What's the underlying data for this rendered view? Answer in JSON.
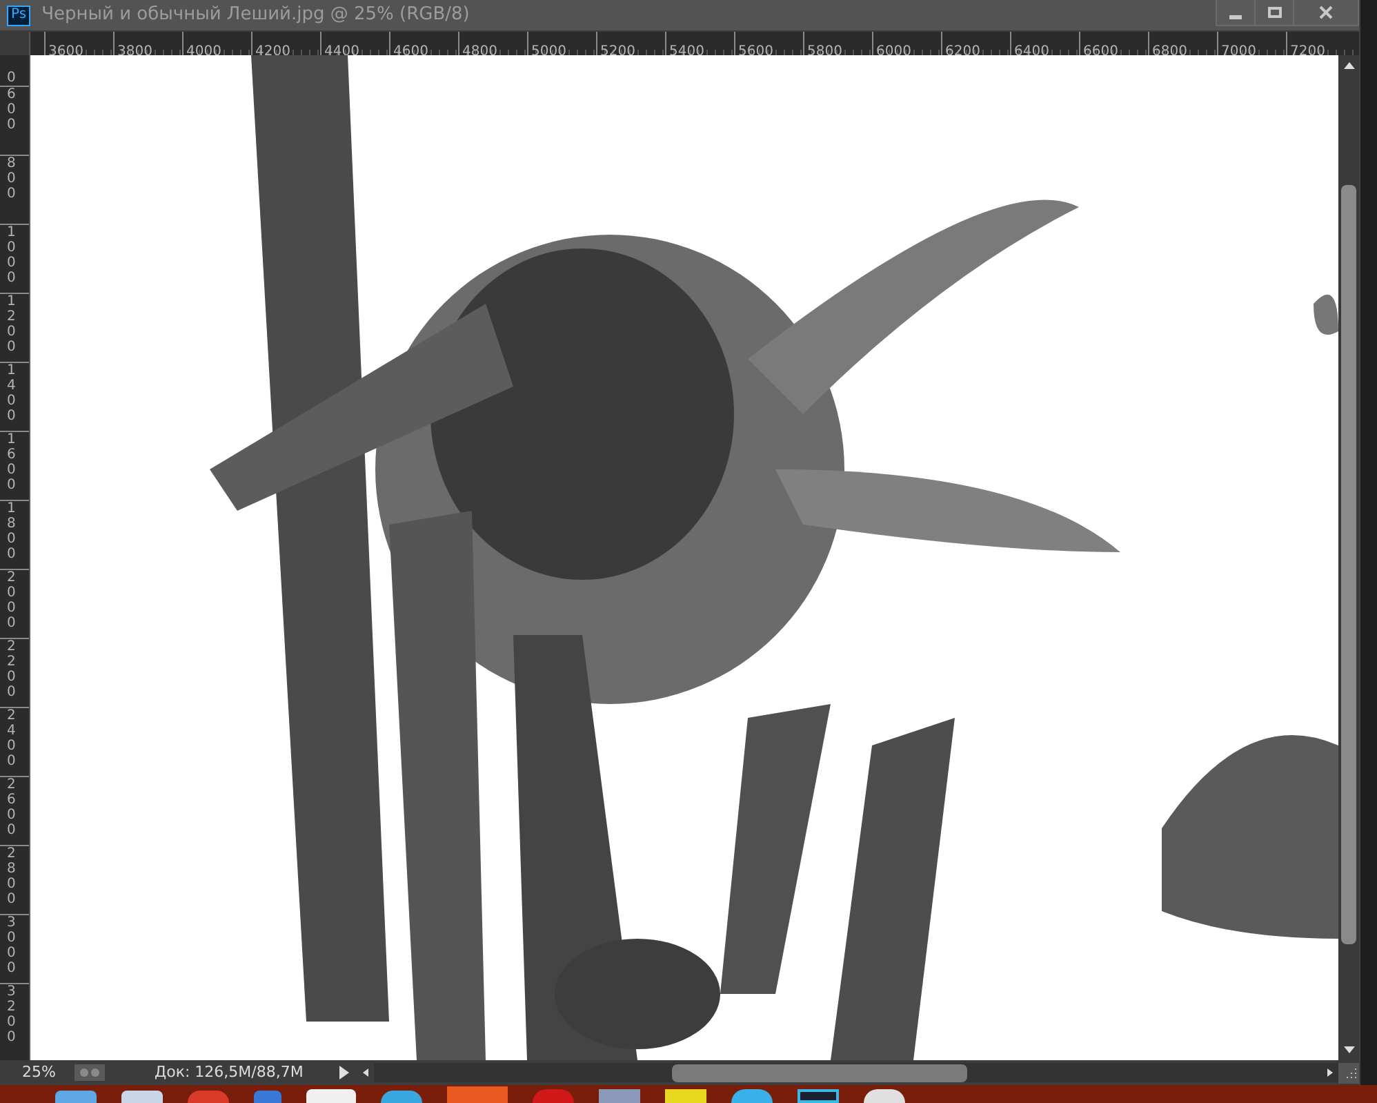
{
  "window": {
    "app_badge": "Ps",
    "title": "Черный и обычный Леший.jpg @ 25% (RGB/8)"
  },
  "ruler_horizontal": [
    "3600",
    "3800",
    "4000",
    "4200",
    "4400",
    "4600",
    "4800",
    "5000",
    "5200",
    "5400",
    "5600",
    "5800",
    "6000",
    "6200",
    "6400",
    "6600",
    "6800",
    "7000",
    "7200"
  ],
  "ruler_vertical": [
    "0",
    "600",
    "800",
    "1000",
    "1200",
    "1400",
    "1600",
    "1800",
    "2000",
    "2200",
    "2400",
    "2600",
    "2800",
    "3000",
    "3200"
  ],
  "status_bar": {
    "zoom": "25%",
    "doc_info": "Док: 126,5M/88,7M"
  }
}
